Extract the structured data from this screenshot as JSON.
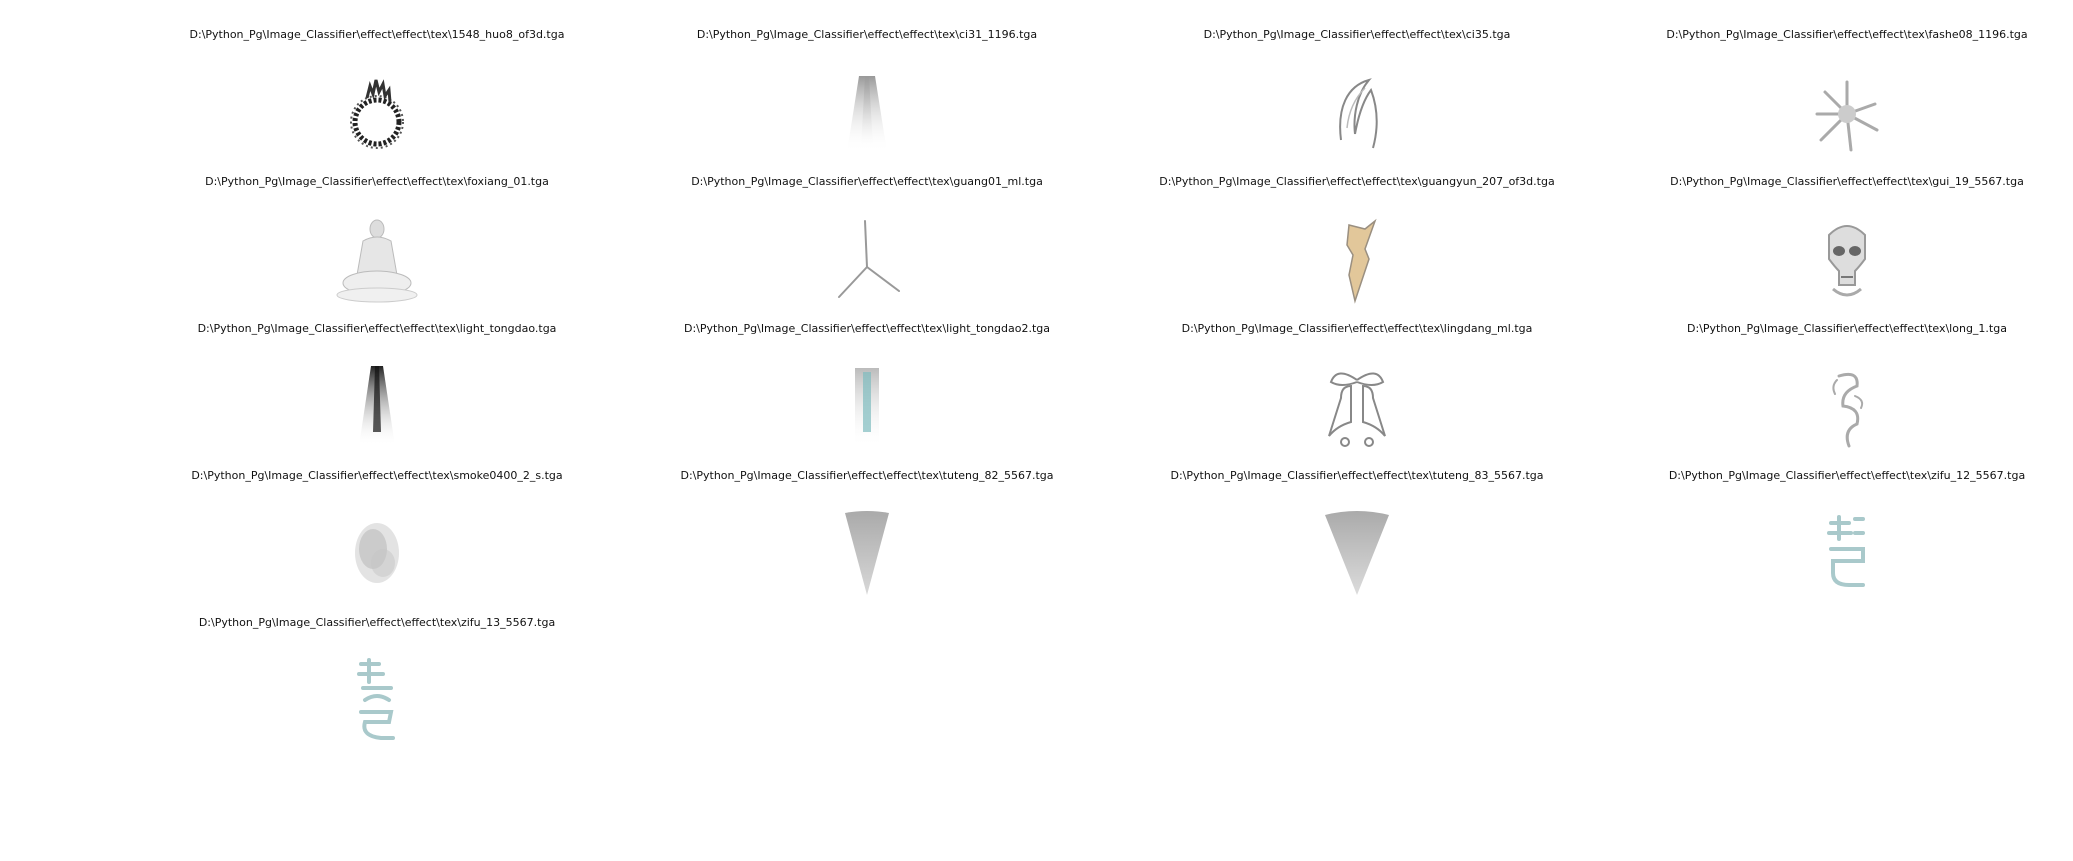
{
  "figure": {
    "items": [
      {
        "path": "D:\\Python_Pg\\Image_Classifier\\effect\\effect\\tex\\1548_huo8_of3d.tga",
        "icon": "fire-ring-icon"
      },
      {
        "path": "D:\\Python_Pg\\Image_Classifier\\effect\\effect\\tex\\ci31_1196.tga",
        "icon": "light-beam-icon"
      },
      {
        "path": "D:\\Python_Pg\\Image_Classifier\\effect\\effect\\tex\\ci35.tga",
        "icon": "claw-slash-icon"
      },
      {
        "path": "D:\\Python_Pg\\Image_Classifier\\effect\\effect\\tex\\fashe08_1196.tga",
        "icon": "burst-splash-icon"
      },
      {
        "path": "D:\\Python_Pg\\Image_Classifier\\effect\\effect\\tex\\foxiang_01.tga",
        "icon": "buddha-statue-icon"
      },
      {
        "path": "D:\\Python_Pg\\Image_Classifier\\effect\\effect\\tex\\guang01_ml.tga",
        "icon": "light-streak-icon"
      },
      {
        "path": "D:\\Python_Pg\\Image_Classifier\\effect\\effect\\tex\\guangyun_207_of3d.tga",
        "icon": "golden-flame-icon"
      },
      {
        "path": "D:\\Python_Pg\\Image_Classifier\\effect\\effect\\tex\\gui_19_5567.tga",
        "icon": "skull-icon"
      },
      {
        "path": "D:\\Python_Pg\\Image_Classifier\\effect\\effect\\tex\\light_tongdao.tga",
        "icon": "dark-beam-icon"
      },
      {
        "path": "D:\\Python_Pg\\Image_Classifier\\effect\\effect\\tex\\light_tongdao2.tga",
        "icon": "teal-beam-icon"
      },
      {
        "path": "D:\\Python_Pg\\Image_Classifier\\effect\\effect\\tex\\lingdang_ml.tga",
        "icon": "bell-icon"
      },
      {
        "path": "D:\\Python_Pg\\Image_Classifier\\effect\\effect\\tex\\long_1.tga",
        "icon": "dragon-icon"
      },
      {
        "path": "D:\\Python_Pg\\Image_Classifier\\effect\\effect\\tex\\smoke0400_2_s.tga",
        "icon": "smoke-icon"
      },
      {
        "path": "D:\\Python_Pg\\Image_Classifier\\effect\\effect\\tex\\tuteng_82_5567.tga",
        "icon": "narrow-fan-icon"
      },
      {
        "path": "D:\\Python_Pg\\Image_Classifier\\effect\\effect\\tex\\tuteng_83_5567.tga",
        "icon": "wide-fan-icon"
      },
      {
        "path": "D:\\Python_Pg\\Image_Classifier\\effect\\effect\\tex\\zifu_12_5567.tga",
        "icon": "glyph-character-icon"
      },
      {
        "path": "D:\\Python_Pg\\Image_Classifier\\effect\\effect\\tex\\zifu_13_5567.tga",
        "icon": "glyph-character-icon"
      }
    ]
  }
}
